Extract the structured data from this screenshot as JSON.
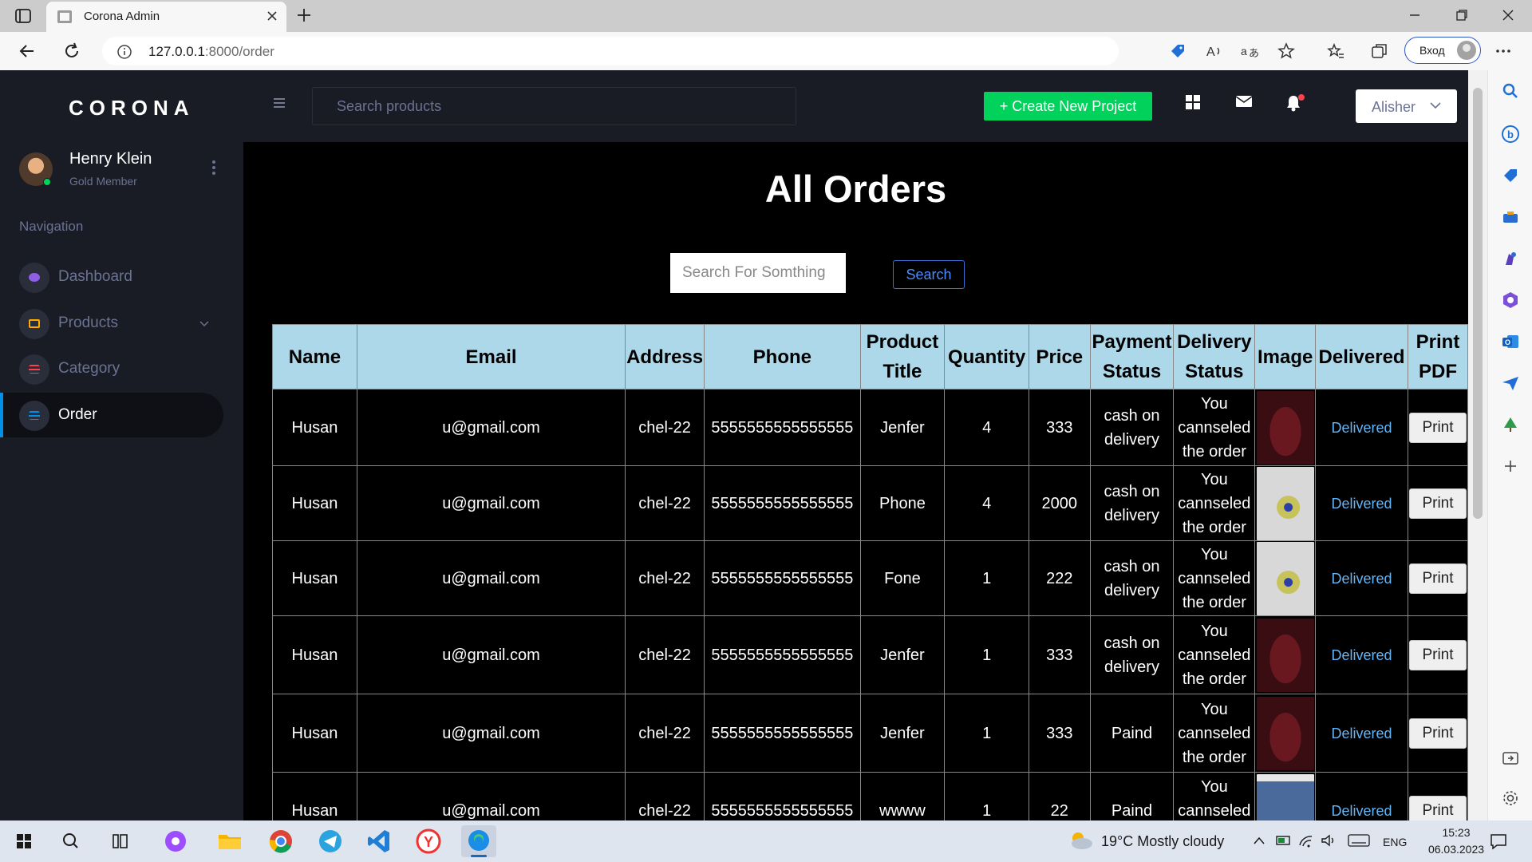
{
  "browser": {
    "tab_title": "Corona Admin",
    "url_host": "127.0.0.1",
    "url_path": ":8000/order",
    "login_label": "Вход"
  },
  "sidebar": {
    "brand": "CORONA",
    "profile": {
      "name": "Henry Klein",
      "role": "Gold Member"
    },
    "nav_heading": "Navigation",
    "items": [
      {
        "label": "Dashboard",
        "icon": "speedometer-icon",
        "color": "#8f5fe8"
      },
      {
        "label": "Products",
        "icon": "laptop-icon",
        "color": "#ffab00"
      },
      {
        "label": "Category",
        "icon": "playlist-icon",
        "color": "#fc424a"
      },
      {
        "label": "Order",
        "icon": "list-icon",
        "color": "#0090e7"
      }
    ]
  },
  "navbar": {
    "search_placeholder": "Search products",
    "create_label": "+ Create New Project",
    "user_label": "Alisher"
  },
  "main": {
    "title": "All Orders",
    "search_placeholder": "Search For Somthing",
    "search_button": "Search"
  },
  "table": {
    "headers": [
      "Name",
      "Email",
      "Address",
      "Phone",
      "Product Title",
      "Quantity",
      "Price",
      "Payment Status",
      "Delivery Status",
      "Image",
      "Delivered",
      "Print PDF"
    ],
    "rows": [
      {
        "name": "Husan",
        "email": "u@gmail.com",
        "address": "chel-22",
        "phone": "5555555555555555",
        "product": "Jenfer",
        "quantity": "4",
        "price": "333",
        "payment": "cash on delivery",
        "delivery": "You cannseled the order",
        "image": "sweater",
        "delivered": "Delivered",
        "print": "Print"
      },
      {
        "name": "Husan",
        "email": "u@gmail.com",
        "address": "chel-22",
        "phone": "5555555555555555",
        "product": "Phone",
        "quantity": "4",
        "price": "2000",
        "payment": "cash on delivery",
        "delivery": "You cannseled the order",
        "image": "phone",
        "delivered": "Delivered",
        "print": "Print"
      },
      {
        "name": "Husan",
        "email": "u@gmail.com",
        "address": "chel-22",
        "phone": "5555555555555555",
        "product": "Fone",
        "quantity": "1",
        "price": "222",
        "payment": "cash on delivery",
        "delivery": "You cannseled the order",
        "image": "phone",
        "delivered": "Delivered",
        "print": "Print"
      },
      {
        "name": "Husan",
        "email": "u@gmail.com",
        "address": "chel-22",
        "phone": "5555555555555555",
        "product": "Jenfer",
        "quantity": "1",
        "price": "333",
        "payment": "cash on delivery",
        "delivery": "You cannseled the order",
        "image": "sweater",
        "delivered": "Delivered",
        "print": "Print"
      },
      {
        "name": "Husan",
        "email": "u@gmail.com",
        "address": "chel-22",
        "phone": "5555555555555555",
        "product": "Jenfer",
        "quantity": "1",
        "price": "333",
        "payment": "Paind",
        "delivery": "You cannseled the order",
        "image": "sweater",
        "delivered": "Delivered",
        "print": "Print"
      },
      {
        "name": "Husan",
        "email": "u@gmail.com",
        "address": "chel-22",
        "phone": "5555555555555555",
        "product": "wwww",
        "quantity": "1",
        "price": "22",
        "payment": "Paind",
        "delivery": "You cannseled the order",
        "image": "jeans",
        "delivered": "Delivered",
        "print": "Print"
      }
    ]
  },
  "taskbar": {
    "weather": "19°C  Mostly cloudy",
    "lang": "ENG",
    "time": "15:23",
    "date": "06.03.2023"
  },
  "colors": {
    "accent_green": "#00d25b",
    "table_header": "#add8ea",
    "link_blue": "#64b5f6",
    "sidebar_bg": "#191c24"
  }
}
